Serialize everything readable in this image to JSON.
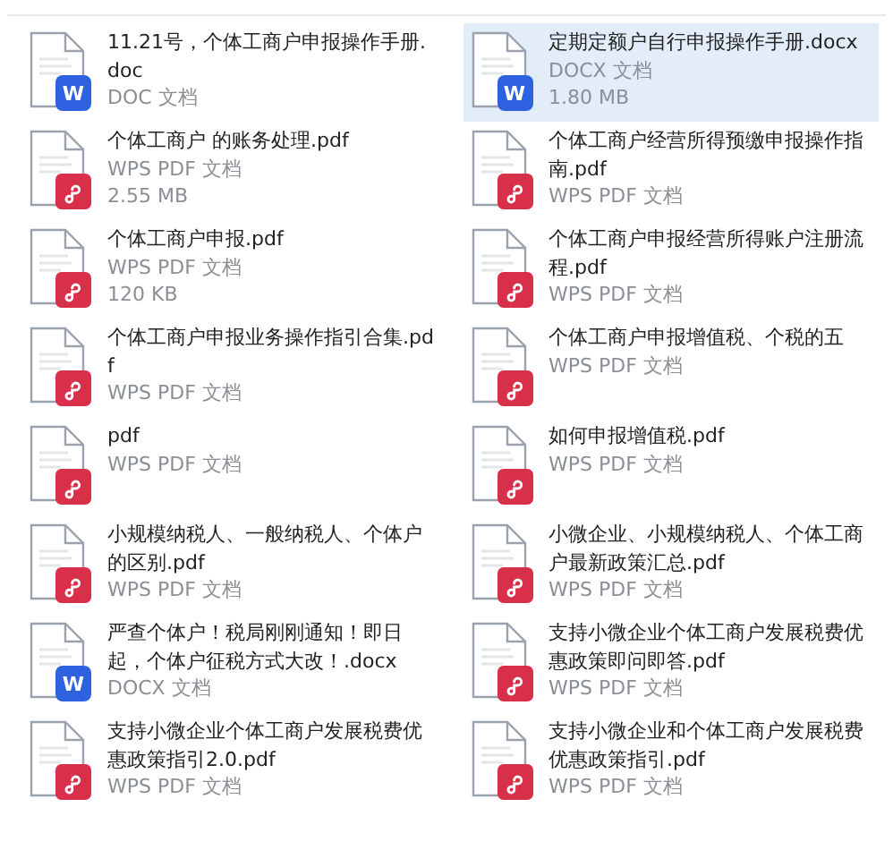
{
  "files": [
    {
      "title": "11.21号，个体工商户申报操作手册.doc",
      "type": "DOC 文档",
      "kind": "word",
      "badge": "W",
      "selected": false
    },
    {
      "title": "定期定额户自行申报操作手册.docx",
      "type": "DOCX 文档",
      "size": "1.80 MB",
      "kind": "word",
      "badge": "W",
      "selected": true
    },
    {
      "title": "个体工商户 的账务处理.pdf",
      "type": "WPS PDF 文档",
      "size": "2.55 MB",
      "kind": "pdf",
      "selected": false
    },
    {
      "title": "个体工商户经营所得预缴申报操作指南.pdf",
      "type": "WPS PDF 文档",
      "kind": "pdf",
      "selected": false
    },
    {
      "title": "个体工商户申报.pdf",
      "type": "WPS PDF 文档",
      "size": "120 KB",
      "kind": "pdf",
      "selected": false
    },
    {
      "title": "个体工商户申报经营所得账户注册流程.pdf",
      "type": "WPS PDF 文档",
      "kind": "pdf",
      "selected": false
    },
    {
      "title": "个体工商户申报业务操作指引合集.pdf",
      "type": "WPS PDF 文档",
      "kind": "pdf",
      "selected": false
    },
    {
      "title": "个体工商户申报增值税、个税的五",
      "type": "WPS PDF 文档",
      "kind": "pdf",
      "selected": false
    },
    {
      "title": "pdf",
      "type": "WPS PDF 文档",
      "kind": "pdf",
      "selected": false
    },
    {
      "title": "如何申报增值税.pdf",
      "type": "WPS PDF 文档",
      "kind": "pdf",
      "selected": false
    },
    {
      "title": "小规模纳税人、一般纳税人、个体户的区别.pdf",
      "type": "WPS PDF 文档",
      "kind": "pdf",
      "selected": false
    },
    {
      "title": "小微企业、小规模纳税人、个体工商户最新政策汇总.pdf",
      "type": "WPS PDF 文档",
      "kind": "pdf",
      "selected": false
    },
    {
      "title": "严查个体户！税局刚刚通知！即日起，个体户征税方式大改！.docx",
      "type": "DOCX 文档",
      "kind": "word",
      "badge": "W",
      "selected": false
    },
    {
      "title": "支持小微企业个体工商户发展税费优惠政策即问即答.pdf",
      "type": "WPS PDF 文档",
      "kind": "pdf",
      "selected": false
    },
    {
      "title": "支持小微企业个体工商户发展税费优惠政策指引2.0.pdf",
      "type": "WPS PDF 文档",
      "kind": "pdf",
      "selected": false
    },
    {
      "title": "支持小微企业和个体工商户发展税费优惠政策指引.pdf",
      "type": "WPS PDF 文档",
      "kind": "pdf",
      "selected": false
    }
  ]
}
